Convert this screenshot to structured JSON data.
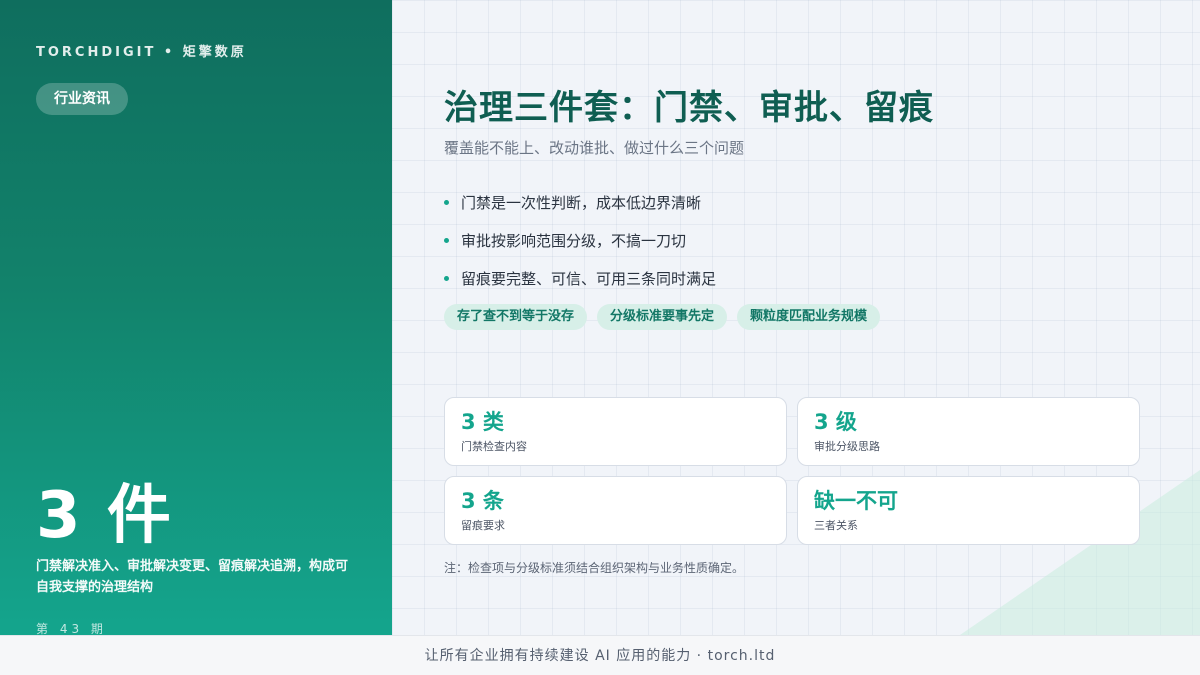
{
  "brand": "TORCHDIGIT • 矩擎数原",
  "category_tag": "行业资讯",
  "highlight": {
    "value": "3 件",
    "description": "门禁解决准入、审批解决变更、留痕解决追溯，构成可自我支撑的治理结构"
  },
  "issue": "第 43 期",
  "title": "治理三件套：门禁、审批、留痕",
  "subtitle": "覆盖能不能上、改动谁批、做过什么三个问题",
  "bullets": [
    "门禁是一次性判断，成本低边界清晰",
    "审批按影响范围分级，不搞一刀切",
    "留痕要完整、可信、可用三条同时满足"
  ],
  "tags": [
    "存了查不到等于没存",
    "分级标准要事先定",
    "颗粒度匹配业务规模"
  ],
  "stats": [
    {
      "value": "3 类",
      "label": "门禁检查内容"
    },
    {
      "value": "3 级",
      "label": "审批分级思路"
    },
    {
      "value": "3 条",
      "label": "留痕要求"
    },
    {
      "value": "缺一不可",
      "label": "三者关系"
    }
  ],
  "note": "注：检查项与分级标准须结合组织架构与业务性质确定。",
  "footer": "让所有企业拥有持续建设 AI 应用的能力 · torch.ltd",
  "colors": {
    "accent": "#14a58d",
    "title": "#0f5e52",
    "panel_dark": "#0f6e5e"
  }
}
